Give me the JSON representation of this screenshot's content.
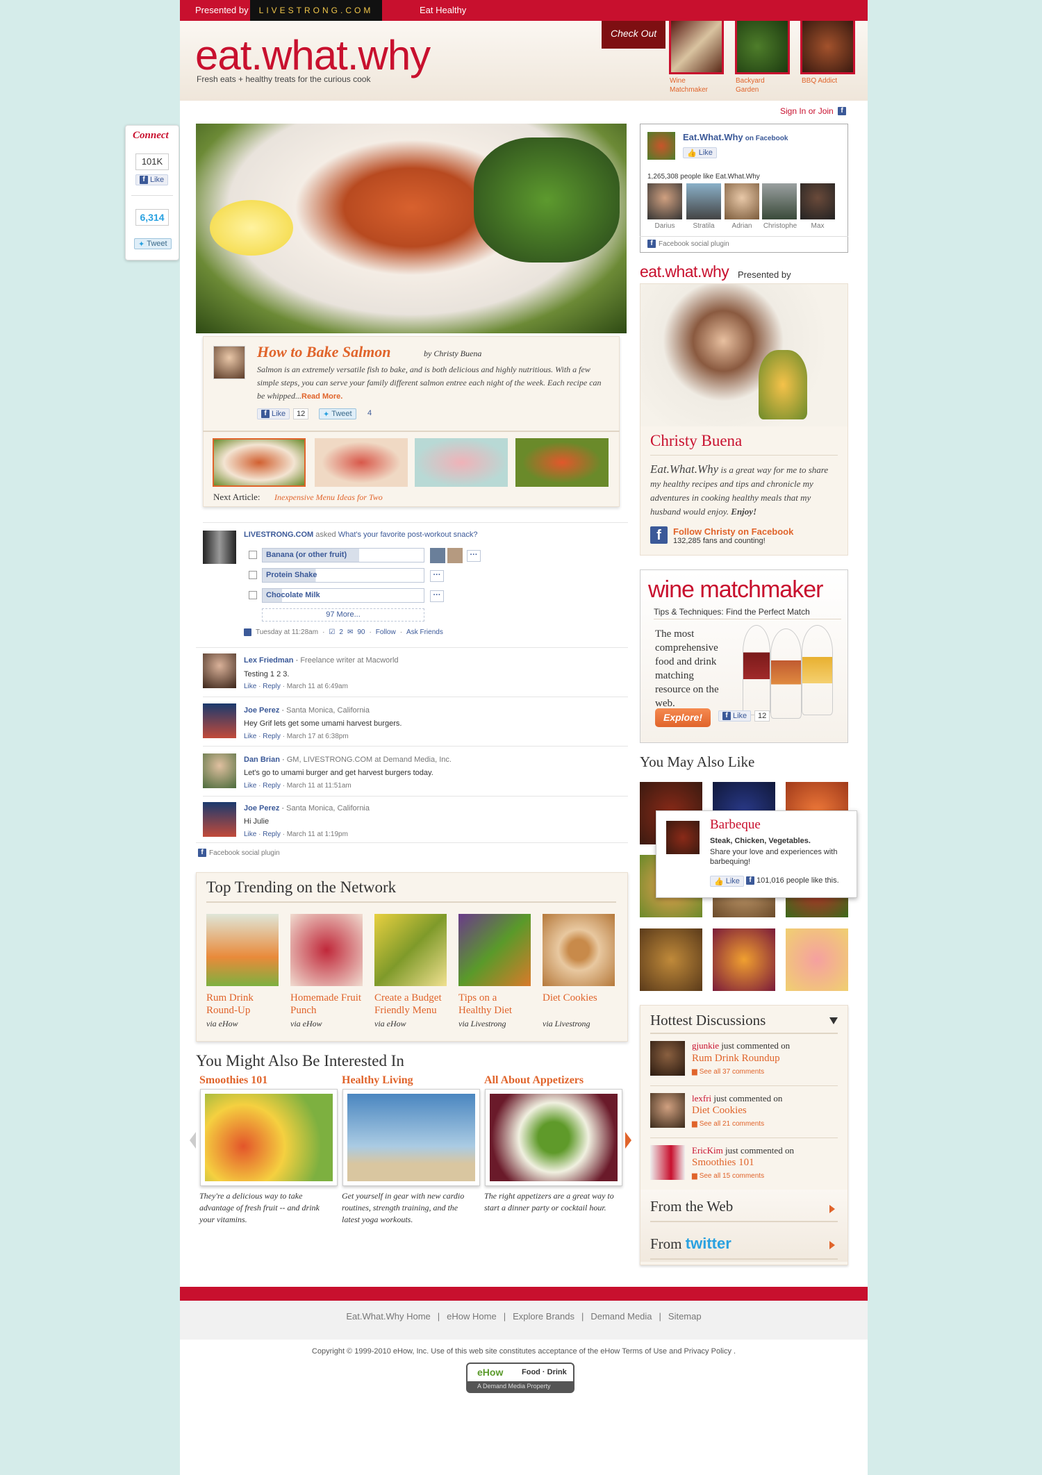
{
  "topbar": {
    "presented": "Presented by",
    "brand": "LIVESTRONG.COM",
    "eat_healthy": "Eat Healthy"
  },
  "header": {
    "logo": "eat.what.why",
    "tagline": "Fresh eats + healthy treats for the curious cook",
    "checkout": "Check Out",
    "checkout_items": [
      {
        "label": "Wine Matchmaker"
      },
      {
        "label": "Backyard Garden"
      },
      {
        "label": "BBQ Addict"
      }
    ],
    "signin": "Sign In or Join"
  },
  "connect": {
    "title": "Connect",
    "fb_count": "101K",
    "like": "Like",
    "tw_count": "6,314",
    "tweet": "Tweet"
  },
  "article": {
    "title": "How to Bake Salmon",
    "byline": "by Christy Buena",
    "excerpt": "Salmon is an extremely versatile fish to bake, and is both delicious and highly nutritious. With a few simple steps, you can serve your family different salmon entree each night of the week. Each recipe can be whipped...",
    "read_more": "Read More.",
    "like": "Like",
    "like_count": "12",
    "tweet": "Tweet",
    "tweet_count": "4",
    "next_label": "Next Article:",
    "next_title": "Inexpensive Menu Ideas for Two"
  },
  "poll": {
    "asker": "LIVESTRONG.COM",
    "asked": "asked",
    "question": "What's your favorite post-workout snack?",
    "options": [
      "Banana (or other fruit)",
      "Protein Shake",
      "Chocolate Milk"
    ],
    "more": "97 More...",
    "meta_time": "Tuesday at 11:28am",
    "meta_votes": "2",
    "meta_comments": "90",
    "follow": "Follow",
    "ask": "Ask Friends"
  },
  "comments": [
    {
      "name": "Lex Friedman",
      "info": "Freelance writer at Macworld",
      "text": "Testing 1 2 3.",
      "like": "Like",
      "reply": "Reply",
      "date": "March 11 at 6:49am"
    },
    {
      "name": "Joe Perez",
      "info": "Santa Monica, California",
      "text": "Hey Grif lets get some umami harvest burgers.",
      "like": "Like",
      "reply": "Reply",
      "date": "March 17 at 6:38pm"
    },
    {
      "name": "Dan Brian",
      "info": "GM, LIVESTRONG.COM at Demand Media, Inc.",
      "text": "Let's go to umami burger and get harvest burgers today.",
      "like": "Like",
      "reply": "Reply",
      "date": "March 11 at 11:51am"
    },
    {
      "name": "Joe Perez",
      "info": "Santa Monica, California",
      "text": "Hi Julie",
      "like": "Like",
      "reply": "Reply",
      "date": "March 11 at 1:19pm"
    }
  ],
  "fb_plugin": "Facebook social plugin",
  "trending": {
    "title": "Top Trending on the Network",
    "items": [
      {
        "title": "Rum Drink Round-Up",
        "via": "via eHow"
      },
      {
        "title": "Homemade Fruit Punch",
        "via": "via eHow"
      },
      {
        "title": "Create a Budget Friendly Menu",
        "via": "via eHow"
      },
      {
        "title": "Tips on a Healthy Diet",
        "via": "via Livestrong"
      },
      {
        "title": "Diet Cookies",
        "via": "via Livestrong"
      }
    ]
  },
  "interested": {
    "title": "You Might Also Be Interested In",
    "items": [
      {
        "title": "Smoothies 101",
        "desc": "They're a delicious way to take advantage of fresh fruit -- and drink your vitamins."
      },
      {
        "title": "Healthy Living",
        "desc": "Get yourself in gear with new cardio routines, strength training, and the latest yoga workouts."
      },
      {
        "title": "All About Appetizers",
        "desc": "The right appetizers are a great way to start a dinner party or cocktail hour."
      }
    ]
  },
  "fbbox": {
    "name": "Eat.What.Why",
    "on": "on Facebook",
    "like": "Like",
    "count": "1,265,308 people like Eat.What.Why",
    "fans": [
      "Darius",
      "Stratila",
      "Adrian",
      "Christophe",
      "Max"
    ],
    "plugin": "Facebook social plugin"
  },
  "presented": {
    "logo": "eat.what.why",
    "label": "Presented by",
    "name": "Christy Buena",
    "blurb_lead": "Eat.What.Why",
    "blurb": " is a great way for me to share my healthy recipes and tips and chronicle my adventures in cooking healthy meals that my husband would enjoy.",
    "enjoy": "Enjoy!",
    "follow": "Follow Christy on Facebook",
    "fans": "132,285 fans and counting!"
  },
  "wine": {
    "title": "wine matchmaker",
    "sub": "Tips & Techniques: Find the Perfect Match",
    "desc": "The most comprehensive food and drink matching resource on the web.",
    "explore": "Explore!",
    "like": "Like",
    "count": "12"
  },
  "also": {
    "title": "You May Also Like",
    "tip_title": "Barbeque",
    "tip_bold": "Steak, Chicken, Vegetables.",
    "tip_text": "Share your love and experiences with barbequing!",
    "tip_like": "Like",
    "tip_count": "101,016 people like this."
  },
  "hottest": {
    "title": "Hottest Discussions",
    "items": [
      {
        "user": "gjunkie",
        "action": "just commented on",
        "topic": "Rum Drink Roundup",
        "all": "See all 37 comments"
      },
      {
        "user": "lexfri",
        "action": "just commented on",
        "topic": "Diet Cookies",
        "all": "See all 21 comments"
      },
      {
        "user": "EricKim",
        "action": "just commented on",
        "topic": "Smoothies 101",
        "all": "See all 15 comments"
      }
    ],
    "web": "From the Web",
    "from": "From",
    "twitter": "twitter"
  },
  "footer": {
    "links": [
      "Eat.What.Why Home",
      "eHow Home",
      "Explore Brands",
      "Demand Media",
      "Sitemap"
    ],
    "copyright": "Copyright © 1999-2010 eHow, Inc.  Use of this web site constitutes acceptance of the eHow Terms of Use and Privacy Policy .",
    "badge_ehow": "eHow",
    "badge_fd": "Food · Drink",
    "badge_sub": "A Demand Media Property"
  }
}
